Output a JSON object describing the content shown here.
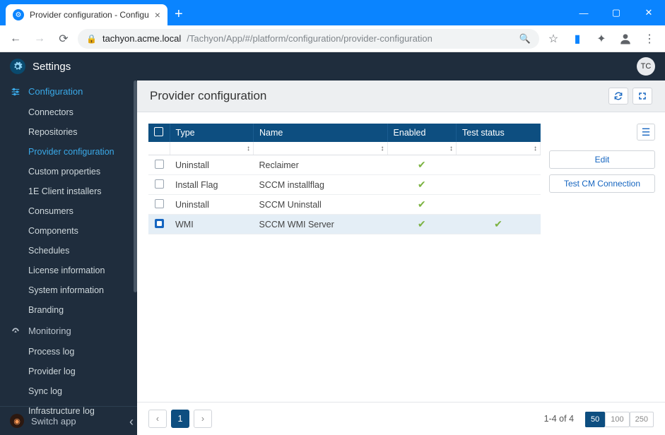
{
  "browser": {
    "tab_title": "Provider configuration - Configu",
    "url_host": "tachyon.acme.local",
    "url_path": "/Tachyon/App/#/platform/configuration/provider-configuration"
  },
  "app": {
    "title": "Settings",
    "avatar": "TC"
  },
  "sidebar": {
    "configuration": "Configuration",
    "items_config": [
      "Connectors",
      "Repositories",
      "Provider configuration",
      "Custom properties",
      "1E Client installers",
      "Consumers",
      "Components",
      "Schedules",
      "License information",
      "System information",
      "Branding"
    ],
    "monitoring": "Monitoring",
    "items_monitoring": [
      "Process log",
      "Provider log",
      "Sync log",
      "Infrastructure log"
    ],
    "switch": "Switch app"
  },
  "page": {
    "title": "Provider configuration",
    "actions": {
      "edit": "Edit",
      "test": "Test CM Connection"
    }
  },
  "table": {
    "headers": {
      "type": "Type",
      "name": "Name",
      "enabled": "Enabled",
      "test": "Test status"
    },
    "rows": [
      {
        "selected": false,
        "type": "Uninstall",
        "name": "Reclaimer",
        "enabled": true,
        "test": false
      },
      {
        "selected": false,
        "type": "Install Flag",
        "name": "SCCM installflag",
        "enabled": true,
        "test": false
      },
      {
        "selected": false,
        "type": "Uninstall",
        "name": "SCCM Uninstall",
        "enabled": true,
        "test": false
      },
      {
        "selected": true,
        "type": "WMI",
        "name": "SCCM WMI Server",
        "enabled": true,
        "test": true
      }
    ]
  },
  "pager": {
    "page": "1",
    "info": "1-4 of 4",
    "sizes": [
      "50",
      "100",
      "250"
    ],
    "active_size": "50"
  }
}
